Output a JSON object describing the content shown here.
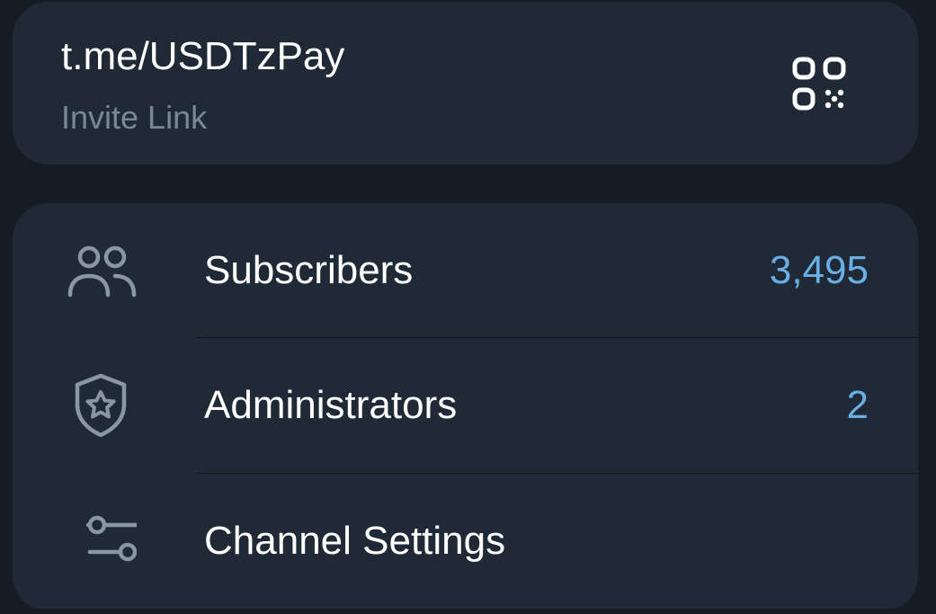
{
  "invite": {
    "link": "t.me/USDTzPay",
    "label": "Invite Link",
    "qr_icon": "qr-code-icon"
  },
  "rows": [
    {
      "icon": "subscribers-icon",
      "label": "Subscribers",
      "value": "3,495"
    },
    {
      "icon": "shield-star-icon",
      "label": "Administrators",
      "value": "2"
    },
    {
      "icon": "sliders-icon",
      "label": "Channel Settings",
      "value": ""
    }
  ],
  "colors": {
    "background": "#151c25",
    "card": "#202a37",
    "text": "#ffffff",
    "muted": "#7b8794",
    "accent": "#6aaee6",
    "icon": "#8a96a3"
  }
}
